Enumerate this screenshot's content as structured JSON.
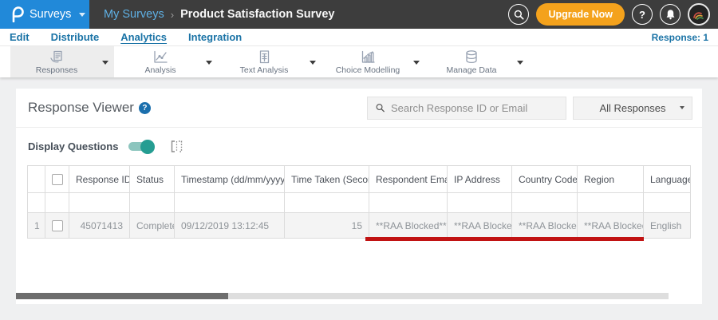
{
  "topbar": {
    "product": "Surveys",
    "breadcrumb": {
      "parent": "My Surveys",
      "separator": "›",
      "current": "Product Satisfaction Survey"
    },
    "upgrade_label": "Upgrade Now",
    "help_glyph": "?"
  },
  "nav": {
    "items": [
      {
        "label": "Edit"
      },
      {
        "label": "Distribute"
      },
      {
        "label": "Analytics",
        "active": true
      },
      {
        "label": "Integration"
      }
    ],
    "response_counter": "Response: 1"
  },
  "toolbar": {
    "modules": [
      {
        "label": "Responses",
        "icon": "responses-icon",
        "active": true
      },
      {
        "label": "Analysis",
        "icon": "analysis-icon",
        "active": false
      },
      {
        "label": "Text Analysis",
        "icon": "text-analysis-icon",
        "active": false
      },
      {
        "label": "Choice Modelling",
        "icon": "choice-modelling-icon",
        "active": false
      },
      {
        "label": "Manage Data",
        "icon": "manage-data-icon",
        "active": false
      }
    ]
  },
  "panel": {
    "title": "Response Viewer",
    "help_glyph": "?",
    "search_placeholder": "Search Response ID or Email",
    "search_value": "",
    "filter_value": "All Responses",
    "display_questions_label": "Display Questions",
    "display_questions_on": true
  },
  "table": {
    "columns": {
      "response_id": "Response ID",
      "status": "Status",
      "timestamp": "Timestamp (dd/mm/yyyy)",
      "time_taken": "Time Taken (Seconds)",
      "respondent_email": "Respondent Email",
      "ip_address": "IP Address",
      "country_code": "Country Code",
      "region": "Region",
      "language": "Language"
    },
    "rows": [
      {
        "index": "1",
        "response_id": "45071413",
        "status": "Completed",
        "timestamp": "09/12/2019 13:12:45",
        "time_taken": "15",
        "respondent_email": "**RAA Blocked**",
        "ip_address": "**RAA Blocked**",
        "country_code": "**RAA Blocked**",
        "region": "**RAA Blocked**",
        "language": "English"
      }
    ]
  },
  "colors": {
    "logo_blue": "#2189d9",
    "topbar_gray": "#3d3d3d",
    "upgrade_orange": "#f4a21c",
    "nav_blue": "#1a73a6",
    "toggle_teal": "#259d92",
    "annotation_red": "#c11313",
    "sort_caret_blue": "#2e86c5"
  }
}
